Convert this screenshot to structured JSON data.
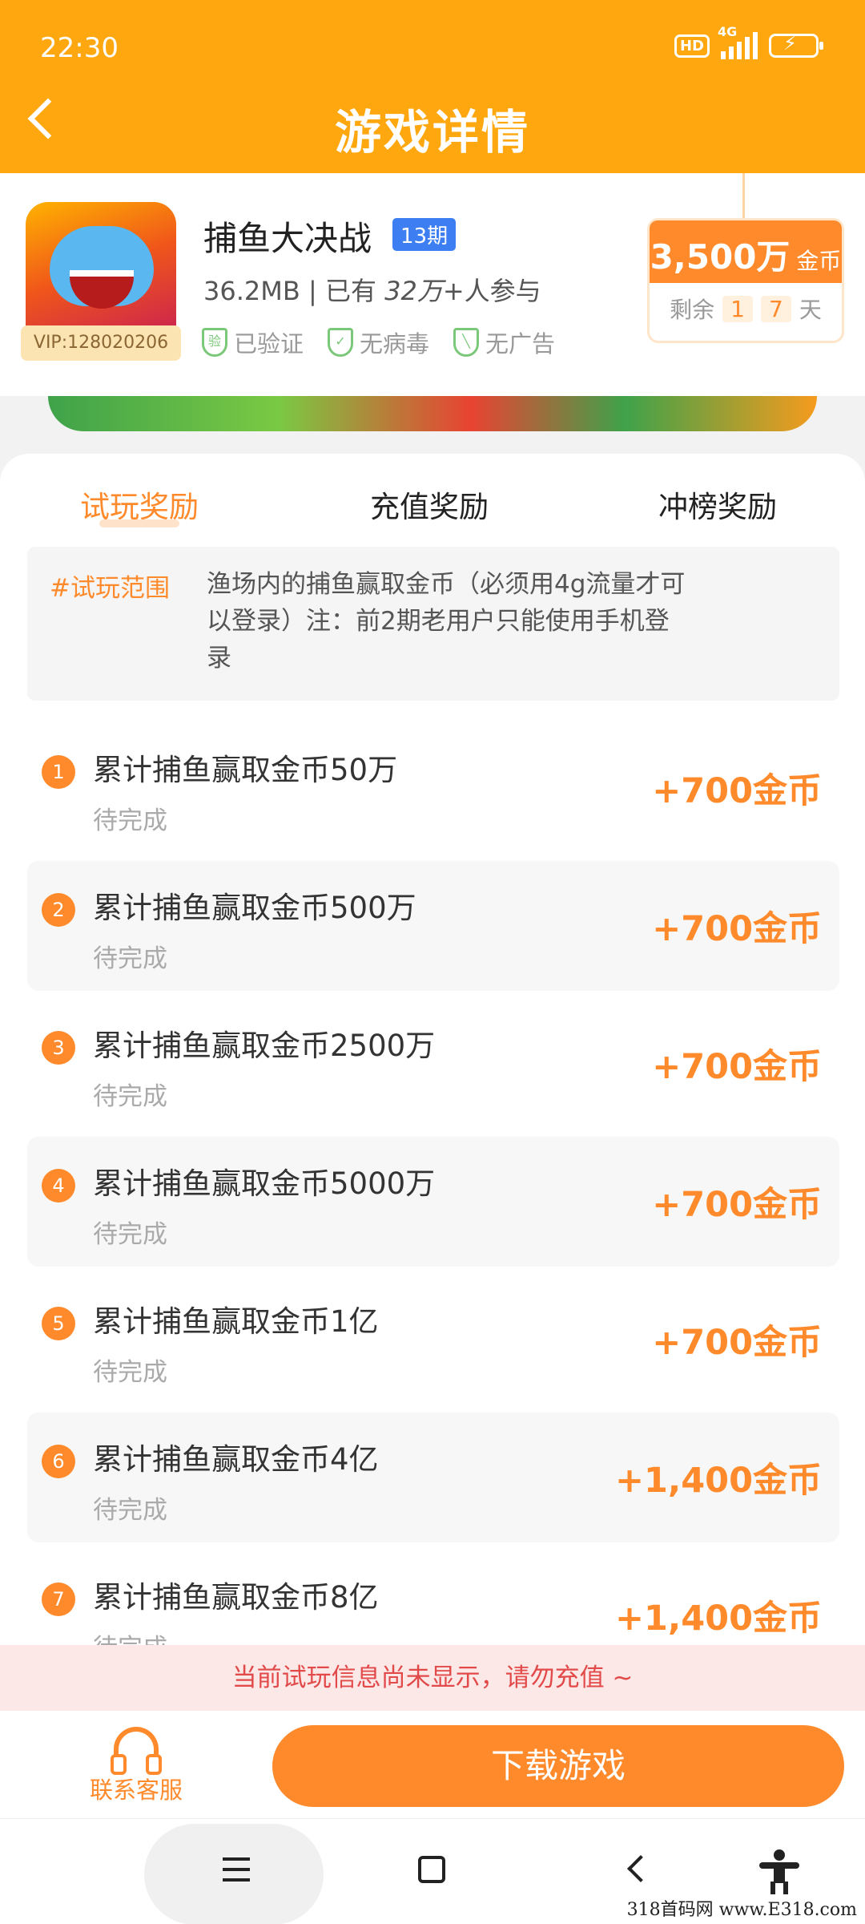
{
  "status_bar": {
    "time": "22:30",
    "hd": "HD",
    "network": "4G"
  },
  "header": {
    "title": "游戏详情"
  },
  "game": {
    "vip": "VIP:128020206",
    "name": "捕鱼大决战",
    "period": "13期",
    "size": "36.2MB",
    "separator": " | 已有 ",
    "participants": "32万+",
    "participants_suffix": "人参与",
    "badges": [
      "已验证",
      "无病毒",
      "无广告"
    ],
    "badge_icons": [
      "verified-shield-icon",
      "check-shield-icon",
      "slash-shield-icon"
    ]
  },
  "reward": {
    "amount": "3,500万",
    "unit": "金币",
    "remain_label": "剩余",
    "days_digits": [
      "1",
      "7"
    ],
    "days_unit": "天"
  },
  "tabs": [
    {
      "label": "试玩奖励",
      "active": true
    },
    {
      "label": "充值奖励",
      "active": false
    },
    {
      "label": "冲榜奖励",
      "active": false
    }
  ],
  "scope": {
    "tag": "#试玩范围",
    "text": "渔场内的捕鱼赢取金币（必须用4g流量才可以登录）注：前2期老用户只能使用手机登录"
  },
  "tasks": [
    {
      "num": "1",
      "title": "累计捕鱼赢取金币50万",
      "status": "待完成",
      "reward": "+700金币"
    },
    {
      "num": "2",
      "title": "累计捕鱼赢取金币500万",
      "status": "待完成",
      "reward": "+700金币"
    },
    {
      "num": "3",
      "title": "累计捕鱼赢取金币2500万",
      "status": "待完成",
      "reward": "+700金币"
    },
    {
      "num": "4",
      "title": "累计捕鱼赢取金币5000万",
      "status": "待完成",
      "reward": "+700金币"
    },
    {
      "num": "5",
      "title": "累计捕鱼赢取金币1亿",
      "status": "待完成",
      "reward": "+700金币"
    },
    {
      "num": "6",
      "title": "累计捕鱼赢取金币4亿",
      "status": "待完成",
      "reward": "+1,400金币"
    },
    {
      "num": "7",
      "title": "累计捕鱼赢取金币8亿",
      "status": "待完成",
      "reward": "+1,400金币"
    }
  ],
  "notice": "当前试玩信息尚未显示，请勿充值 ~",
  "bottom": {
    "support_label": "联系客服",
    "download_label": "下载游戏"
  },
  "watermark": "318首码网 www.E318.com",
  "colors": {
    "header": "#ffa70f",
    "accent": "#ff8a2b",
    "period_badge": "#3d7ff2",
    "notice_bg": "#fde8e8",
    "notice_text": "#e24a4a"
  }
}
